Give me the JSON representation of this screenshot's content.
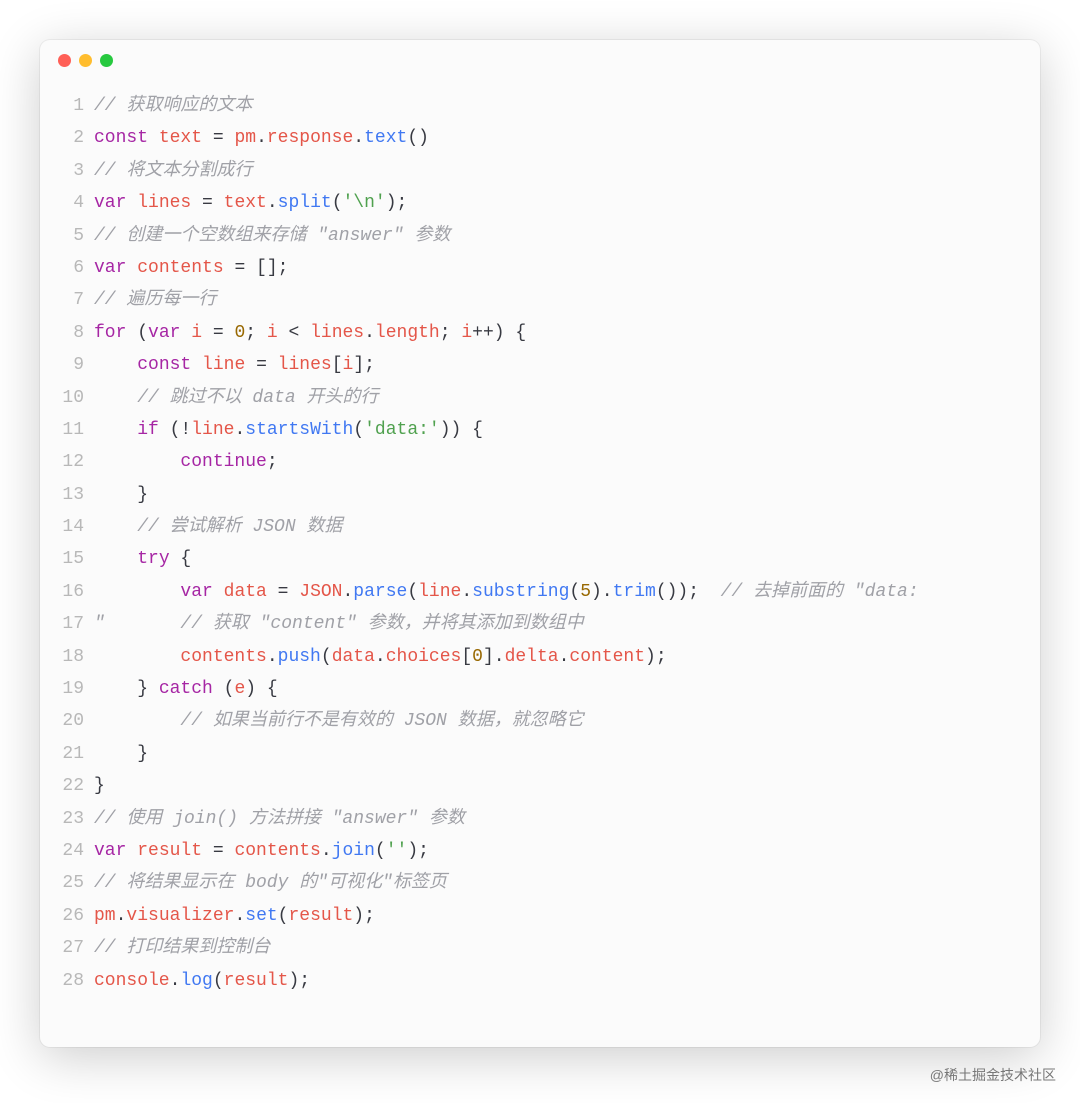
{
  "watermark": "@稀土掘金技术社区",
  "window": {
    "dots": [
      "red",
      "yellow",
      "green"
    ]
  },
  "code": {
    "lines": [
      {
        "n": 1,
        "tokens": [
          [
            "comment",
            "// 获取响应的文本"
          ]
        ]
      },
      {
        "n": 2,
        "tokens": [
          [
            "keyword",
            "const"
          ],
          [
            "op",
            " "
          ],
          [
            "var",
            "text"
          ],
          [
            "op",
            " = "
          ],
          [
            "var",
            "pm"
          ],
          [
            "punct",
            "."
          ],
          [
            "var",
            "response"
          ],
          [
            "punct",
            "."
          ],
          [
            "name",
            "text"
          ],
          [
            "punct",
            "()"
          ]
        ]
      },
      {
        "n": 3,
        "tokens": [
          [
            "comment",
            "// 将文本分割成行"
          ]
        ]
      },
      {
        "n": 4,
        "tokens": [
          [
            "keyword",
            "var"
          ],
          [
            "op",
            " "
          ],
          [
            "var",
            "lines"
          ],
          [
            "op",
            " = "
          ],
          [
            "var",
            "text"
          ],
          [
            "punct",
            "."
          ],
          [
            "name",
            "split"
          ],
          [
            "punct",
            "("
          ],
          [
            "string",
            "'\\n'"
          ],
          [
            "punct",
            ");"
          ]
        ]
      },
      {
        "n": 5,
        "tokens": [
          [
            "comment",
            "// 创建一个空数组来存储 \"answer\" 参数"
          ]
        ]
      },
      {
        "n": 6,
        "tokens": [
          [
            "keyword",
            "var"
          ],
          [
            "op",
            " "
          ],
          [
            "var",
            "contents"
          ],
          [
            "op",
            " = [];"
          ]
        ]
      },
      {
        "n": 7,
        "tokens": [
          [
            "comment",
            "// 遍历每一行"
          ]
        ]
      },
      {
        "n": 8,
        "tokens": [
          [
            "keyword",
            "for"
          ],
          [
            "op",
            " ("
          ],
          [
            "keyword",
            "var"
          ],
          [
            "op",
            " "
          ],
          [
            "var",
            "i"
          ],
          [
            "op",
            " = "
          ],
          [
            "num",
            "0"
          ],
          [
            "op",
            "; "
          ],
          [
            "var",
            "i"
          ],
          [
            "op",
            " < "
          ],
          [
            "var",
            "lines"
          ],
          [
            "punct",
            "."
          ],
          [
            "var",
            "length"
          ],
          [
            "op",
            "; "
          ],
          [
            "var",
            "i"
          ],
          [
            "op",
            "++) {"
          ]
        ]
      },
      {
        "n": 9,
        "tokens": [
          [
            "op",
            "    "
          ],
          [
            "keyword",
            "const"
          ],
          [
            "op",
            " "
          ],
          [
            "var",
            "line"
          ],
          [
            "op",
            " = "
          ],
          [
            "var",
            "lines"
          ],
          [
            "punct",
            "["
          ],
          [
            "var",
            "i"
          ],
          [
            "punct",
            "];"
          ]
        ]
      },
      {
        "n": 10,
        "tokens": [
          [
            "op",
            "    "
          ],
          [
            "comment",
            "// 跳过不以 data 开头的行"
          ]
        ]
      },
      {
        "n": 11,
        "tokens": [
          [
            "op",
            "    "
          ],
          [
            "keyword",
            "if"
          ],
          [
            "op",
            " (!"
          ],
          [
            "var",
            "line"
          ],
          [
            "punct",
            "."
          ],
          [
            "name",
            "startsWith"
          ],
          [
            "punct",
            "("
          ],
          [
            "string",
            "'data:'"
          ],
          [
            "punct",
            ")) {"
          ]
        ]
      },
      {
        "n": 12,
        "tokens": [
          [
            "op",
            "        "
          ],
          [
            "keyword",
            "continue"
          ],
          [
            "punct",
            ";"
          ]
        ]
      },
      {
        "n": 13,
        "tokens": [
          [
            "op",
            "    }"
          ]
        ]
      },
      {
        "n": 14,
        "tokens": [
          [
            "op",
            "    "
          ],
          [
            "comment",
            "// 尝试解析 JSON 数据"
          ]
        ]
      },
      {
        "n": 15,
        "tokens": [
          [
            "op",
            "    "
          ],
          [
            "keyword",
            "try"
          ],
          [
            "op",
            " {"
          ]
        ]
      },
      {
        "n": 16,
        "tokens": [
          [
            "op",
            "        "
          ],
          [
            "keyword",
            "var"
          ],
          [
            "op",
            " "
          ],
          [
            "var",
            "data"
          ],
          [
            "op",
            " = "
          ],
          [
            "var",
            "JSON"
          ],
          [
            "punct",
            "."
          ],
          [
            "name",
            "parse"
          ],
          [
            "punct",
            "("
          ],
          [
            "var",
            "line"
          ],
          [
            "punct",
            "."
          ],
          [
            "name",
            "substring"
          ],
          [
            "punct",
            "("
          ],
          [
            "num",
            "5"
          ],
          [
            "punct",
            ")."
          ],
          [
            "name",
            "trim"
          ],
          [
            "punct",
            "());  "
          ],
          [
            "comment",
            "// 去掉前面的 \"data:"
          ]
        ]
      },
      {
        "n": 17,
        "tokens": [
          [
            "comment",
            "\"       // 获取 \"content\" 参数，并将其添加到数组中"
          ]
        ]
      },
      {
        "n": 18,
        "tokens": [
          [
            "op",
            "        "
          ],
          [
            "var",
            "contents"
          ],
          [
            "punct",
            "."
          ],
          [
            "name",
            "push"
          ],
          [
            "punct",
            "("
          ],
          [
            "var",
            "data"
          ],
          [
            "punct",
            "."
          ],
          [
            "var",
            "choices"
          ],
          [
            "punct",
            "["
          ],
          [
            "num",
            "0"
          ],
          [
            "punct",
            "]."
          ],
          [
            "var",
            "delta"
          ],
          [
            "punct",
            "."
          ],
          [
            "var",
            "content"
          ],
          [
            "punct",
            ");"
          ]
        ]
      },
      {
        "n": 19,
        "tokens": [
          [
            "op",
            "    } "
          ],
          [
            "keyword",
            "catch"
          ],
          [
            "op",
            " ("
          ],
          [
            "var",
            "e"
          ],
          [
            "op",
            ") {"
          ]
        ]
      },
      {
        "n": 20,
        "tokens": [
          [
            "op",
            "        "
          ],
          [
            "comment",
            "// 如果当前行不是有效的 JSON 数据，就忽略它"
          ]
        ]
      },
      {
        "n": 21,
        "tokens": [
          [
            "op",
            "    }"
          ]
        ]
      },
      {
        "n": 22,
        "tokens": [
          [
            "op",
            "}"
          ]
        ]
      },
      {
        "n": 23,
        "tokens": [
          [
            "comment",
            "// 使用 join() 方法拼接 \"answer\" 参数"
          ]
        ]
      },
      {
        "n": 24,
        "tokens": [
          [
            "keyword",
            "var"
          ],
          [
            "op",
            " "
          ],
          [
            "var",
            "result"
          ],
          [
            "op",
            " = "
          ],
          [
            "var",
            "contents"
          ],
          [
            "punct",
            "."
          ],
          [
            "name",
            "join"
          ],
          [
            "punct",
            "("
          ],
          [
            "string",
            "''"
          ],
          [
            "punct",
            ");"
          ]
        ]
      },
      {
        "n": 25,
        "tokens": [
          [
            "comment",
            "// 将结果显示在 body 的\"可视化\"标签页"
          ]
        ]
      },
      {
        "n": 26,
        "tokens": [
          [
            "var",
            "pm"
          ],
          [
            "punct",
            "."
          ],
          [
            "var",
            "visualizer"
          ],
          [
            "punct",
            "."
          ],
          [
            "name",
            "set"
          ],
          [
            "punct",
            "("
          ],
          [
            "var",
            "result"
          ],
          [
            "punct",
            ");"
          ]
        ]
      },
      {
        "n": 27,
        "tokens": [
          [
            "comment",
            "// 打印结果到控制台"
          ]
        ]
      },
      {
        "n": 28,
        "tokens": [
          [
            "var",
            "console"
          ],
          [
            "punct",
            "."
          ],
          [
            "name",
            "log"
          ],
          [
            "punct",
            "("
          ],
          [
            "var",
            "result"
          ],
          [
            "punct",
            ");"
          ]
        ]
      }
    ]
  }
}
